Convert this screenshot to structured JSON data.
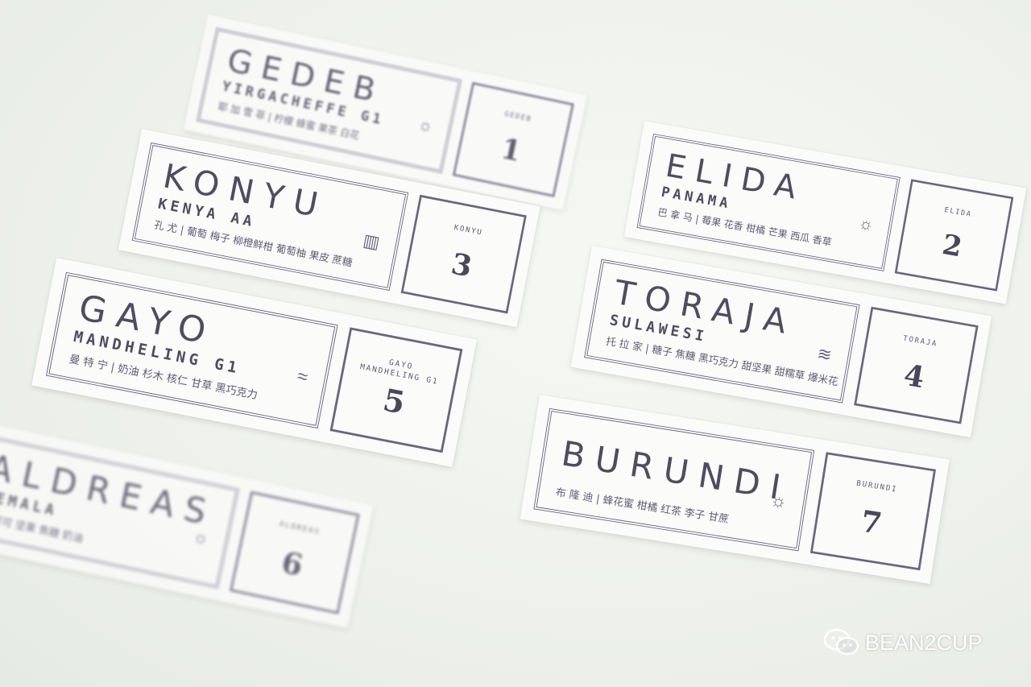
{
  "cards": [
    {
      "id": "gedeb",
      "name": "GEDEB",
      "origin": "YIRGACHEFFE G1",
      "notes": "耶 加 雪 菲 | 柠檬 蜂蜜 果茶 白花",
      "symbol": "☼",
      "number_label": "GEDEB",
      "number": "1"
    },
    {
      "id": "konyu",
      "name": "KONYU",
      "origin": "KENYA AA",
      "notes": "孔 尤 | 葡萄 梅子 柳橙鲜柑 葡萄柚 果皮 蔗糖",
      "symbol": "▥",
      "number_label": "KONYU",
      "number": "3"
    },
    {
      "id": "gayo",
      "name": "GAYO",
      "origin": "MANDHELING G1",
      "notes": "曼 特 宁 | 奶油 杉木 核仁 甘草 黑巧克力",
      "symbol": "≈",
      "number_label": "GAYO\nMANDHELING G1",
      "number": "5"
    },
    {
      "id": "aldreas",
      "name": "ALDREAS",
      "origin": "TEMALA",
      "notes": "· | 可可 坚果 焦糖 奶油",
      "symbol": "☼",
      "number_label": "ALDREAS",
      "number": "6"
    },
    {
      "id": "elida",
      "name": "ELIDA",
      "origin": "PANAMA",
      "notes": "巴 拿 马 | 莓果 花香 柑橘 芒果 西瓜 香草",
      "symbol": "☼",
      "number_label": "ELIDA",
      "number": "2"
    },
    {
      "id": "toraja",
      "name": "TORAJA",
      "origin": "SULAWESI",
      "notes": "托 拉 家 | 糖子 焦糖 黑巧克力 甜坚果 甜糯草 爆米花",
      "symbol": "≋",
      "number_label": "TORAJA",
      "number": "4"
    },
    {
      "id": "burundi",
      "name": "BURUNDI",
      "origin": "",
      "notes": "布 隆 迪 | 蜂花蜜 柑橘 红茶 李子 甘蔗",
      "symbol": "☼",
      "number_label": "BURUNDI",
      "number": "7"
    }
  ],
  "watermark": {
    "text": "BEAN2CUP",
    "icon": "wechat-icon"
  },
  "colors": {
    "ink": "#4f4c60",
    "frame": "#6a6580",
    "paper": "#fbfbfa",
    "background": "#eef1ec"
  }
}
